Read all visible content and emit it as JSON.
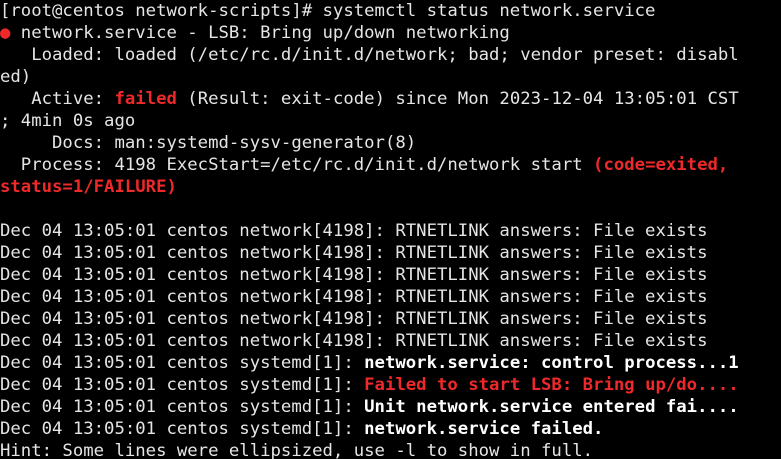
{
  "terminal": {
    "prompt": "[root@centos network-scripts]# ",
    "command": "systemctl status network.service",
    "unit_dot": "●",
    "unit_line": " network.service - LSB: Bring up/down networking",
    "loaded_line_1": "   Loaded: loaded (/etc/rc.d/init.d/network; bad; vendor preset: disabl",
    "loaded_line_2": "ed)",
    "active_prefix": "   Active: ",
    "active_state": "failed",
    "active_rest": " (Result: exit-code) since Mon 2023-12-04 13:05:01 CST",
    "active_line_2": "; 4min 0s ago",
    "docs_line": "     Docs: man:systemd-sysv-generator(8)",
    "process_prefix": "  Process: 4198 ExecStart=/etc/rc.d/init.d/network start ",
    "process_code": "(code=exited,",
    "process_status": "status=1/FAILURE)",
    "log_lines": [
      {
        "prefix": "Dec 04 13:05:01 centos network[4198]: ",
        "message": "RTNETLINK answers: File exists",
        "style": "normal"
      },
      {
        "prefix": "Dec 04 13:05:01 centos network[4198]: ",
        "message": "RTNETLINK answers: File exists",
        "style": "normal"
      },
      {
        "prefix": "Dec 04 13:05:01 centos network[4198]: ",
        "message": "RTNETLINK answers: File exists",
        "style": "normal"
      },
      {
        "prefix": "Dec 04 13:05:01 centos network[4198]: ",
        "message": "RTNETLINK answers: File exists",
        "style": "normal"
      },
      {
        "prefix": "Dec 04 13:05:01 centos network[4198]: ",
        "message": "RTNETLINK answers: File exists",
        "style": "normal"
      },
      {
        "prefix": "Dec 04 13:05:01 centos network[4198]: ",
        "message": "RTNETLINK answers: File exists",
        "style": "normal"
      },
      {
        "prefix": "Dec 04 13:05:01 centos systemd[1]: ",
        "message": "network.service: control process...1",
        "style": "bold"
      },
      {
        "prefix": "Dec 04 13:05:01 centos systemd[1]: ",
        "message": "Failed to start LSB: Bring up/do....",
        "style": "red"
      },
      {
        "prefix": "Dec 04 13:05:01 centos systemd[1]: ",
        "message": "Unit network.service entered fai....",
        "style": "bold"
      },
      {
        "prefix": "Dec 04 13:05:01 centos systemd[1]: ",
        "message": "network.service failed.",
        "style": "bold"
      }
    ],
    "hint_line": "Hint: Some lines were ellipsized, use -l to show in full.",
    "colors": {
      "background": "#000000",
      "foreground": "#e5e5e5",
      "error_red": "#ef2929",
      "bold_white": "#ffffff"
    }
  }
}
